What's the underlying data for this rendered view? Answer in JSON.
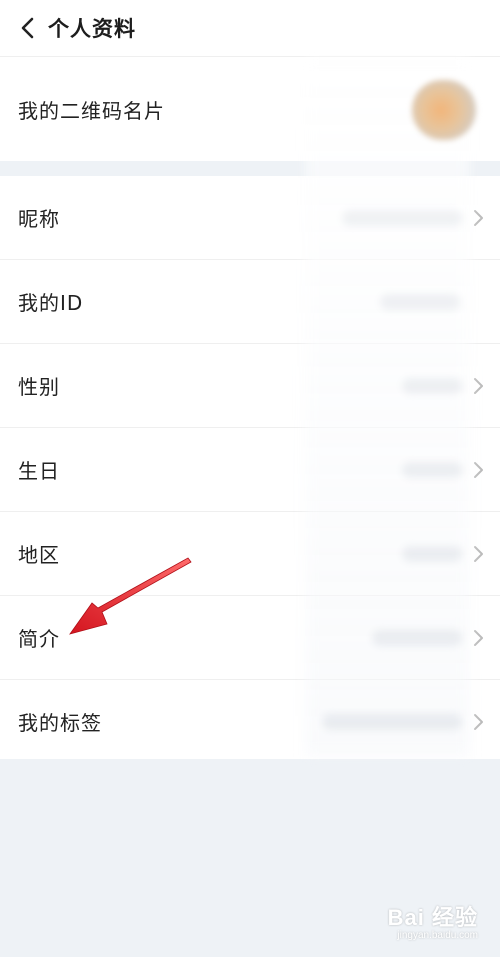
{
  "header": {
    "back_icon": "chevron-left-icon",
    "title": "个人资料"
  },
  "qr_row": {
    "label": "我的二维码名片"
  },
  "profile_rows": [
    {
      "label": "昵称",
      "has_chevron": true
    },
    {
      "label": "我的ID",
      "has_chevron": false
    },
    {
      "label": "性别",
      "has_chevron": true
    },
    {
      "label": "生日",
      "has_chevron": true
    },
    {
      "label": "地区",
      "has_chevron": true
    },
    {
      "label": "简介",
      "has_chevron": true
    },
    {
      "label": "我的标签",
      "has_chevron": true
    }
  ],
  "annotation": {
    "arrow_color": "#e8202a",
    "points_to": "简介"
  },
  "watermark": {
    "main": "Bai 经验",
    "url": "jingyan.baidu.com"
  },
  "colors": {
    "background": "#eef2f6",
    "card": "#ffffff",
    "divider": "#efefef",
    "text": "#222222",
    "chevron": "#bbbbbb"
  }
}
